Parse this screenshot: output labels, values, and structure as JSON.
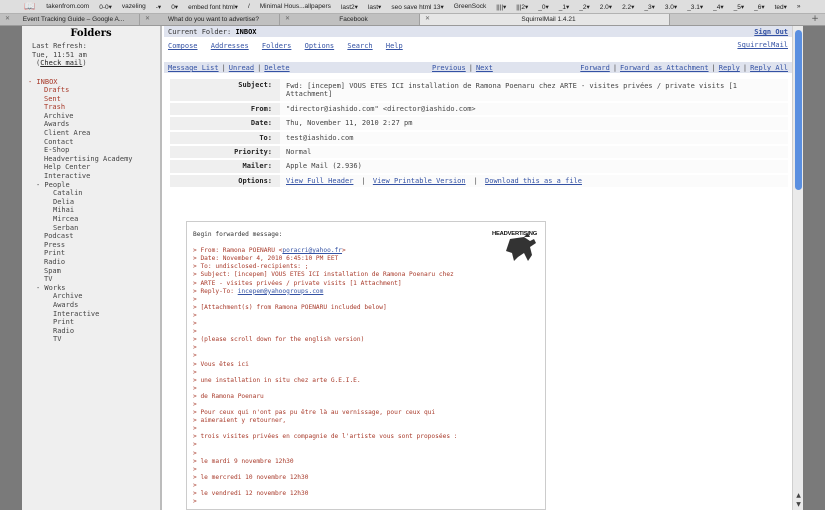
{
  "browser": {
    "bookmarks": [
      "takenfrom.com",
      "0-0▾",
      "vazeling",
      "-▾",
      "0▾",
      "embed font html▾",
      "/",
      "Minimal Hous...allpapers",
      "last2▾",
      "last▾",
      "seo save html 13▾",
      "GreenSock",
      "||||▾",
      "|||2▾",
      "_0▾",
      "_1▾",
      "_2▾",
      "2.0▾",
      "2.2▾",
      "_3▾",
      "3.0▾",
      "_3.1▾",
      "_4▾",
      "_5▾",
      "_6▾",
      "ted▾",
      "»"
    ],
    "tabs": [
      {
        "title": "Event Tracking Guide – Google A...",
        "active": false
      },
      {
        "title": "What do you want to advertise?",
        "active": false
      },
      {
        "title": "Facebook",
        "active": false
      },
      {
        "title": "SquirrelMail 1.4.21",
        "active": true
      }
    ],
    "new_tab": "+"
  },
  "folders": {
    "title": "Folders",
    "last_refresh_label": "Last Refresh:",
    "last_refresh_time": "Tue, 11:51 am",
    "check_mail": "Check mail",
    "items": [
      {
        "text": "- INBOX",
        "level": "l0",
        "red": true
      },
      {
        "text": "Drafts",
        "level": "l1",
        "red": true
      },
      {
        "text": "Sent",
        "level": "l1",
        "red": true
      },
      {
        "text": "Trash",
        "level": "l1",
        "red": true
      },
      {
        "text": "Archive",
        "level": "l1",
        "red": false
      },
      {
        "text": "Awards",
        "level": "l1",
        "red": false
      },
      {
        "text": "Client Area",
        "level": "l1",
        "red": false
      },
      {
        "text": "Contact",
        "level": "l1",
        "red": false
      },
      {
        "text": "E-Shop",
        "level": "l1",
        "red": false
      },
      {
        "text": "Headvertising Academy",
        "level": "l1",
        "red": false
      },
      {
        "text": "Help Center",
        "level": "l1",
        "red": false
      },
      {
        "text": "Interactive",
        "level": "l1",
        "red": false
      },
      {
        "text": "- People",
        "level": "l1m",
        "red": false
      },
      {
        "text": "Catalin",
        "level": "l2",
        "red": false
      },
      {
        "text": "Delia",
        "level": "l2",
        "red": false
      },
      {
        "text": "Mihai",
        "level": "l2",
        "red": false
      },
      {
        "text": "Mircea",
        "level": "l2",
        "red": false
      },
      {
        "text": "Serban",
        "level": "l2",
        "red": false
      },
      {
        "text": "Podcast",
        "level": "l1",
        "red": false
      },
      {
        "text": "Press",
        "level": "l1",
        "red": false
      },
      {
        "text": "Print",
        "level": "l1",
        "red": false
      },
      {
        "text": "Radio",
        "level": "l1",
        "red": false
      },
      {
        "text": "Spam",
        "level": "l1",
        "red": false
      },
      {
        "text": "TV",
        "level": "l1",
        "red": false
      },
      {
        "text": "- Works",
        "level": "l1m",
        "red": false
      },
      {
        "text": "Archive",
        "level": "l2",
        "red": false
      },
      {
        "text": "Awards",
        "level": "l2",
        "red": false
      },
      {
        "text": "Interactive",
        "level": "l2",
        "red": false
      },
      {
        "text": "Print",
        "level": "l2",
        "red": false
      },
      {
        "text": "Radio",
        "level": "l2",
        "red": false
      },
      {
        "text": "TV",
        "level": "l2",
        "red": false
      }
    ]
  },
  "top": {
    "current_folder_label": "Current Folder:",
    "current_folder": "INBOX",
    "sign_out": "Sign Out",
    "menu": [
      "Compose",
      "Addresses",
      "Folders",
      "Options",
      "Search",
      "Help"
    ],
    "brand": "SquirrelMail"
  },
  "nav": {
    "left": [
      "Message List",
      "Unread",
      "Delete"
    ],
    "middle": [
      "Previous",
      "Next"
    ],
    "right": [
      "Forward",
      "Forward as Attachment",
      "Reply",
      "Reply All"
    ]
  },
  "headers": {
    "subject_label": "Subject:",
    "subject": "Fwd: [incepem] VOUS ETES ICI installation de Ramona Poenaru chez ARTE - visites privées / private visits [1 Attachment]",
    "from_label": "From:",
    "from": "\"director@iashido.com\" <director@iashido.com>",
    "date_label": "Date:",
    "date": "Thu, November 11, 2010 2:27 pm",
    "to_label": "To:",
    "to": "test@iashido.com",
    "priority_label": "Priority:",
    "priority": "Normal",
    "mailer_label": "Mailer:",
    "mailer": "Apple Mail (2.936)",
    "options_label": "Options:",
    "options": [
      "View Full Header",
      "View Printable Version",
      "Download this as a file"
    ]
  },
  "message": {
    "logo_text": "HEADVERTISING",
    "intro": "Begin forwarded message:",
    "from_prefix": "> From: Ramona POENARU <",
    "from_email": "poracri@yahoo.fr",
    "from_suffix": ">",
    "date_line": "> Date: November 4, 2010 6:45:10 PM EET",
    "to_line": "> To: undisclosed-recipients: ;",
    "subject_line1": "> Subject: [incepem] VOUS ETES ICI installation de Ramona Poenaru chez",
    "subject_line2": "> ARTE - visites privées / private visits [1 Attachment]",
    "replyto_prefix": "> Reply-To: ",
    "replyto_email": "incepem@yahoogroups.com",
    "gt": ">",
    "attachment_line": "> [Attachment(s) from Ramona POENARU included below]",
    "scroll_line": "> (please scroll down for the english version)",
    "vous_line": "> Vous êtes ici",
    "install_line": "> une installation in situ chez arte G.E.I.E.",
    "ramona_line": "> de Ramona Poenaru",
    "pour_line1": "> Pour ceux qui n'ont pas pu être là au vernissage, pour ceux qui",
    "pour_line2": "> aimeraient y retourner,",
    "trois_line": "> trois visites privées en compagnie de l'artiste vous sont proposées :",
    "mardi_line": "> le mardi 9 novembre 12h30",
    "mercredi_line": "> le mercredi 10 novembre 12h30",
    "vendredi_line": "> le vendredi 12 novembre 12h30"
  },
  "colors": {
    "link": "#3452a4",
    "quoted": "#a83a2a",
    "header_bar": "#dfe3ee",
    "scroll_thumb": "#5a8fe0"
  }
}
